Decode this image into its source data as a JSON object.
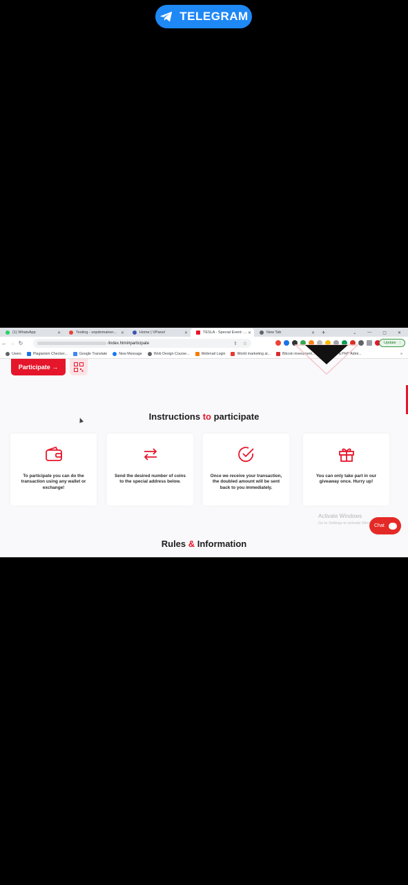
{
  "overlay": {
    "badge_label": "TELEGRAM"
  },
  "browser": {
    "tabs": [
      {
        "label": "(1) WhatsApp",
        "color": "#25d366",
        "active": false
      },
      {
        "label": "Testing - unpdomainer...",
        "color": "#ea4335",
        "active": false
      },
      {
        "label": "Home | VPanel",
        "color": "#3f51b5",
        "active": false
      },
      {
        "label": "TESLA - Special Event: ...",
        "color": "#e5162b",
        "active": true
      },
      {
        "label": "New Tab",
        "color": "#5f6368",
        "active": false
      }
    ],
    "new_tab_label": "+",
    "url": "/index.html#participate",
    "update_label": "Update",
    "bookmarks": [
      {
        "label": "Users",
        "color": "#5f6368"
      },
      {
        "label": "Plagiarism Checker...",
        "color": "#1a73e8"
      },
      {
        "label": "Google Translate",
        "color": "#4285f4"
      },
      {
        "label": "New Message",
        "color": "#1877f2"
      },
      {
        "label": "Web Design Course...",
        "color": "#5f6368"
      },
      {
        "label": "Webmail Login",
        "color": "#f57c00"
      },
      {
        "label": "World marketing al...",
        "color": "#e53935"
      },
      {
        "label": "Bitcoin investment...",
        "color": "#d32f2f"
      },
      {
        "label": "Create a PHP Admi...",
        "color": "#3f51b5"
      }
    ]
  },
  "page": {
    "participate_label": "Participate →",
    "section_title_part1": "Instructions ",
    "section_title_accent": "to",
    "section_title_part2": " participate",
    "cards": [
      {
        "icon": "wallet-icon",
        "text": "To participate you can do the transaction using any wallet or exchange!"
      },
      {
        "icon": "exchange-arrows-icon",
        "text": "Send the desired number of coins to the special address below."
      },
      {
        "icon": "check-circle-icon",
        "text": "Once we receive your transaction, the doubled amount will be sent back to you immediately."
      },
      {
        "icon": "gift-icon",
        "text": "You can only take part in our giveaway once. Hurry up!"
      }
    ],
    "watermark_title": "Activate Windows",
    "watermark_sub": "Go to Settings to activate Windows.",
    "chat_label": "Chat",
    "rules_part1": "Rules ",
    "rules_accent": "&",
    "rules_part2": " Information",
    "accent_color": "#e5162b"
  }
}
